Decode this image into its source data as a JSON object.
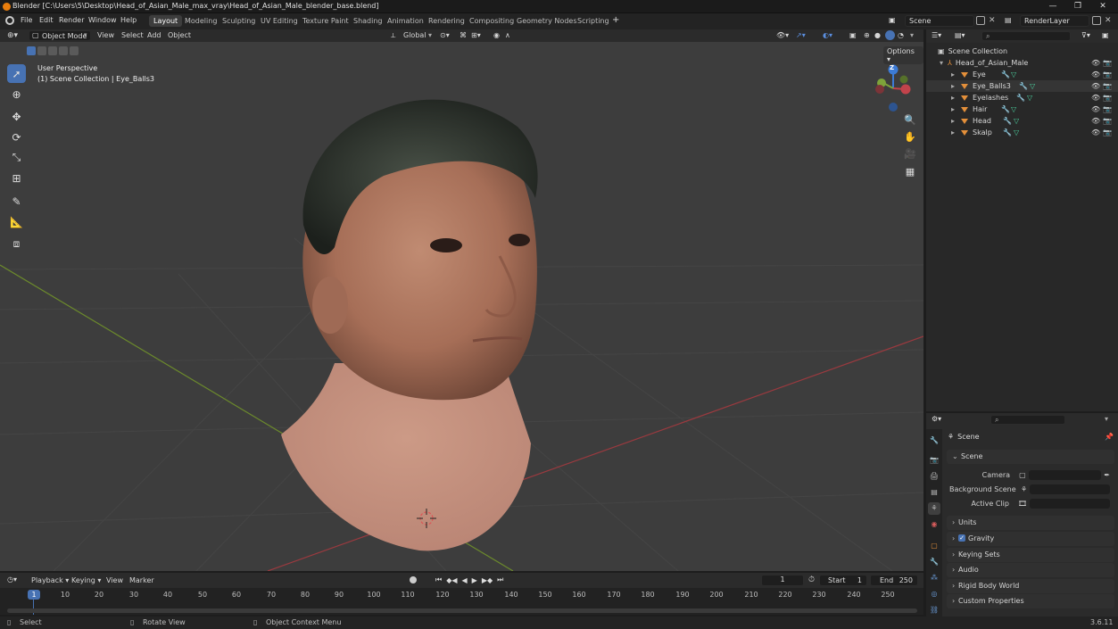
{
  "titlebar": {
    "title": "Blender [C:\\Users\\5\\Desktop\\Head_of_Asian_Male_max_vray\\Head_of_Asian_Male_blender_base.blend]",
    "minimize": "—",
    "maximize": "❐",
    "close": "✕"
  },
  "menu": [
    "File",
    "Edit",
    "Render",
    "Window",
    "Help"
  ],
  "workspaces": [
    "Layout",
    "Modeling",
    "Sculpting",
    "UV Editing",
    "Texture Paint",
    "Shading",
    "Animation",
    "Rendering",
    "Compositing",
    "Geometry Nodes",
    "Scripting"
  ],
  "workspace_add": "+",
  "scene_field": "Scene",
  "view_layer_field": "RenderLayer",
  "viewport_header": {
    "mode": "Object Mode",
    "menus": [
      "View",
      "Select",
      "Add",
      "Object"
    ],
    "orientation": "Global",
    "options": "Options"
  },
  "viewport": {
    "perspective": "User Perspective",
    "collection_info": "(1) Scene Collection | Eye_Balls3",
    "gizmo_z": "Z",
    "colors": {
      "x_axis": "#c2434b",
      "y_axis": "#7ea33a",
      "z_axis": "#3c7bd6",
      "background": "#3d3d3d",
      "active_tool": "#4772b3"
    }
  },
  "timeline": {
    "menus": [
      "Playback",
      "Keying",
      "View",
      "Marker"
    ],
    "current_frame": "1",
    "start_label": "Start",
    "start_value": "1",
    "end_label": "End",
    "end_value": "250",
    "ticks": [
      "10",
      "20",
      "30",
      "40",
      "50",
      "60",
      "70",
      "80",
      "90",
      "100",
      "110",
      "120",
      "130",
      "140",
      "150",
      "160",
      "170",
      "180",
      "190",
      "200",
      "210",
      "220",
      "230",
      "240",
      "250"
    ],
    "playhead": "1"
  },
  "statusbar": {
    "select": "Select",
    "rotate": "Rotate View",
    "context": "Object Context Menu",
    "version": "3.6.11"
  },
  "outliner": {
    "root": "Scene Collection",
    "collection": "Head_of_Asian_Male",
    "objects": [
      "Eye",
      "Eye_Balls3",
      "Eyelashes",
      "Hair",
      "Head",
      "Skalp"
    ]
  },
  "properties": {
    "context": "Scene",
    "section": "Scene",
    "camera_label": "Camera",
    "background_label": "Background Scene",
    "clip_label": "Active Clip",
    "panels": [
      "Units",
      "Gravity",
      "Keying Sets",
      "Audio",
      "Rigid Body World",
      "Custom Properties"
    ]
  }
}
